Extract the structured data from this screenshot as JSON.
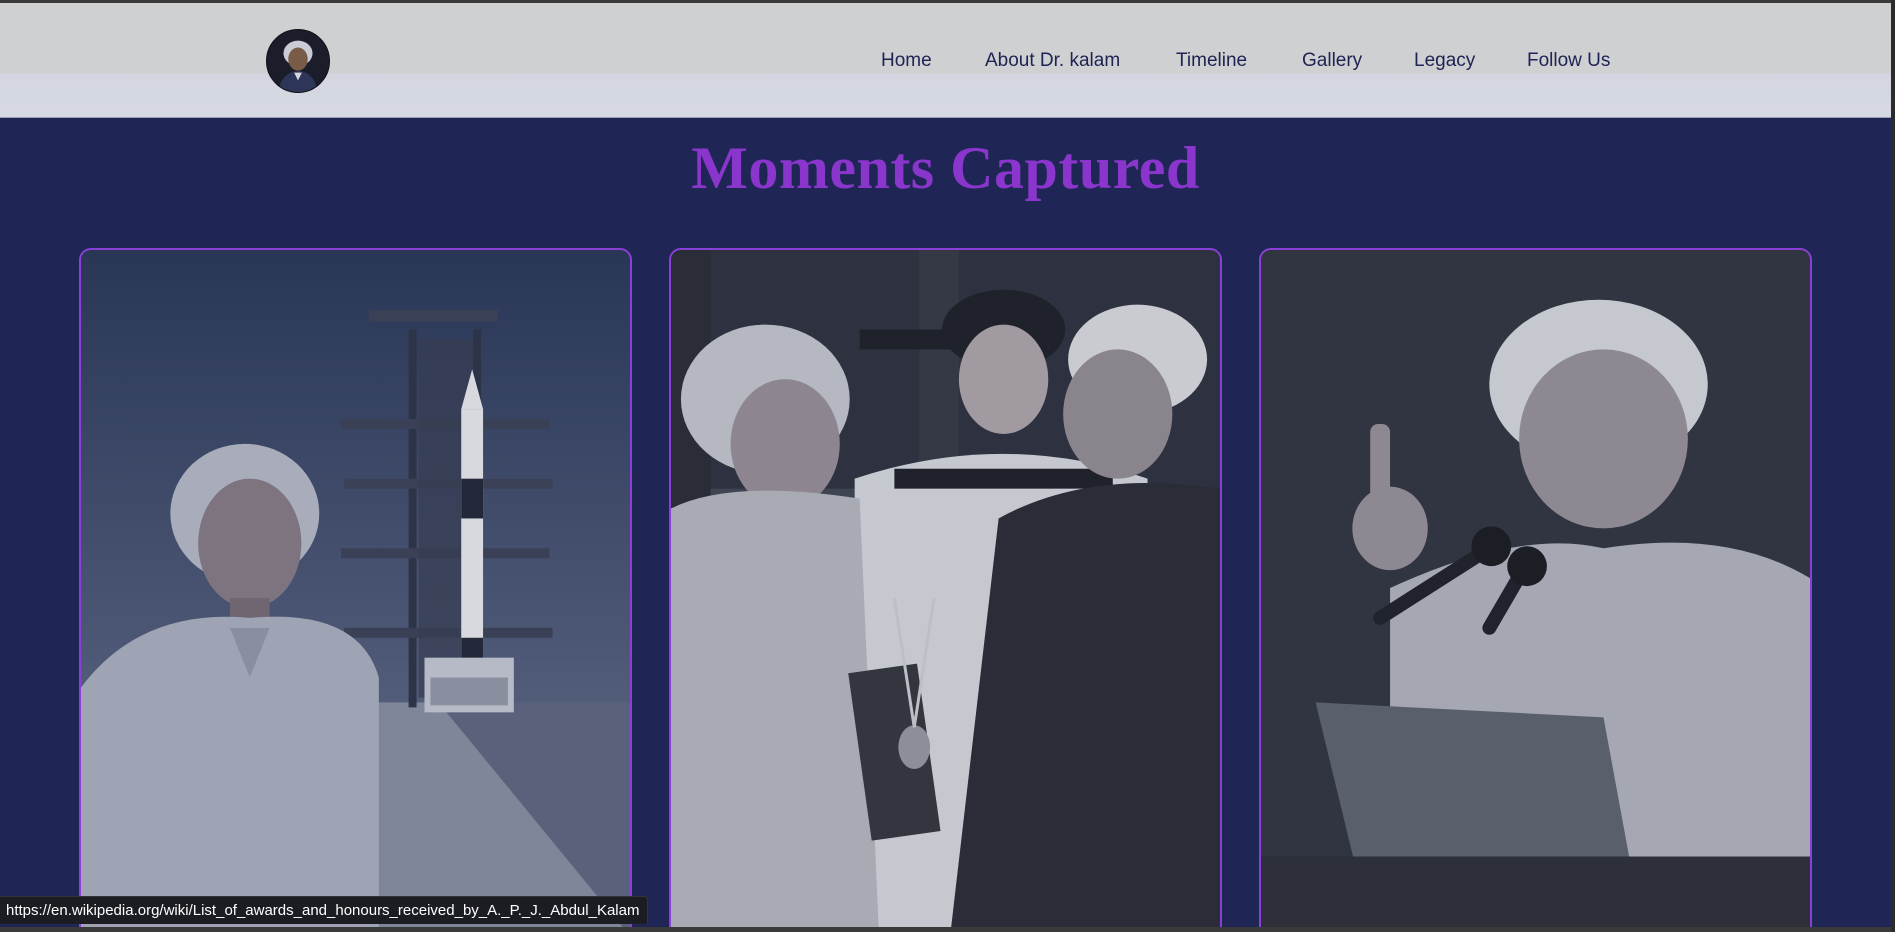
{
  "navbar": {
    "logo_alt": "Dr. A.P.J. Abdul Kalam portrait",
    "links": [
      {
        "label": "Home"
      },
      {
        "label": "About Dr. kalam"
      },
      {
        "label": "Timeline"
      },
      {
        "label": "Gallery"
      },
      {
        "label": "Legacy"
      },
      {
        "label": "Follow Us"
      }
    ]
  },
  "gallery": {
    "title": "Moments Captured",
    "cards": [
      {
        "alt": "Dr. Kalam standing in front of a rocket on its launch pad"
      },
      {
        "alt": "Dr. Kalam receiving a medal award from the President"
      },
      {
        "alt": "Dr. Kalam speaking at a podium with raised finger"
      }
    ]
  },
  "status_bar": {
    "url": "https://en.wikipedia.org/wiki/List_of_awards_and_honours_received_by_A._P._J._Abdul_Kalam"
  },
  "colors": {
    "page_background": "#1f2656",
    "navbar_background": "#d3d6e0",
    "nav_text": "#1d2352",
    "title": "#8a35cc",
    "card_border": "#8a3fd6"
  }
}
